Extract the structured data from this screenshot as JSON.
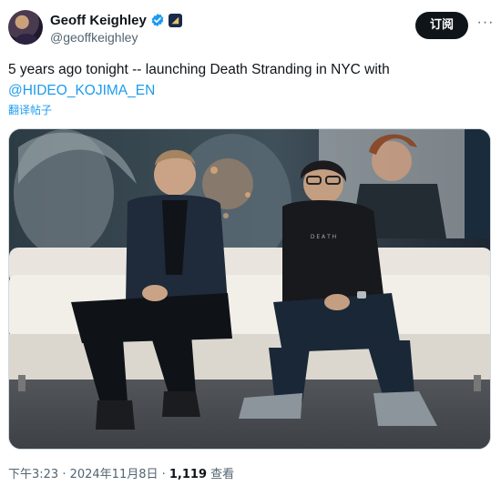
{
  "author": {
    "display_name": "Geoff Keighley",
    "handle": "@geoffkeighley"
  },
  "actions": {
    "follow_label": "订阅",
    "more_label": "···"
  },
  "tweet": {
    "text_before_mention": "5 years ago tonight -- launching Death Stranding in NYC with ",
    "mention": "@HIDEO_KOJIMA_EN",
    "translate_label": "翻译帖子"
  },
  "media": {
    "alt": "Two men sitting on a white couch in front of a Death Stranding backdrop"
  },
  "meta": {
    "timestamp": "下午3:23 · 2024年11月8日 · ",
    "views_count": "1,119",
    "views_label": " 查看"
  },
  "colors": {
    "accent": "#1d9bf0",
    "text": "#0f1419",
    "muted": "#536471",
    "button_bg": "#0f1419"
  },
  "icons": {
    "verified": "verified-badge-icon",
    "affiliate": "affiliate-badge-icon",
    "more": "more-dots-icon"
  }
}
